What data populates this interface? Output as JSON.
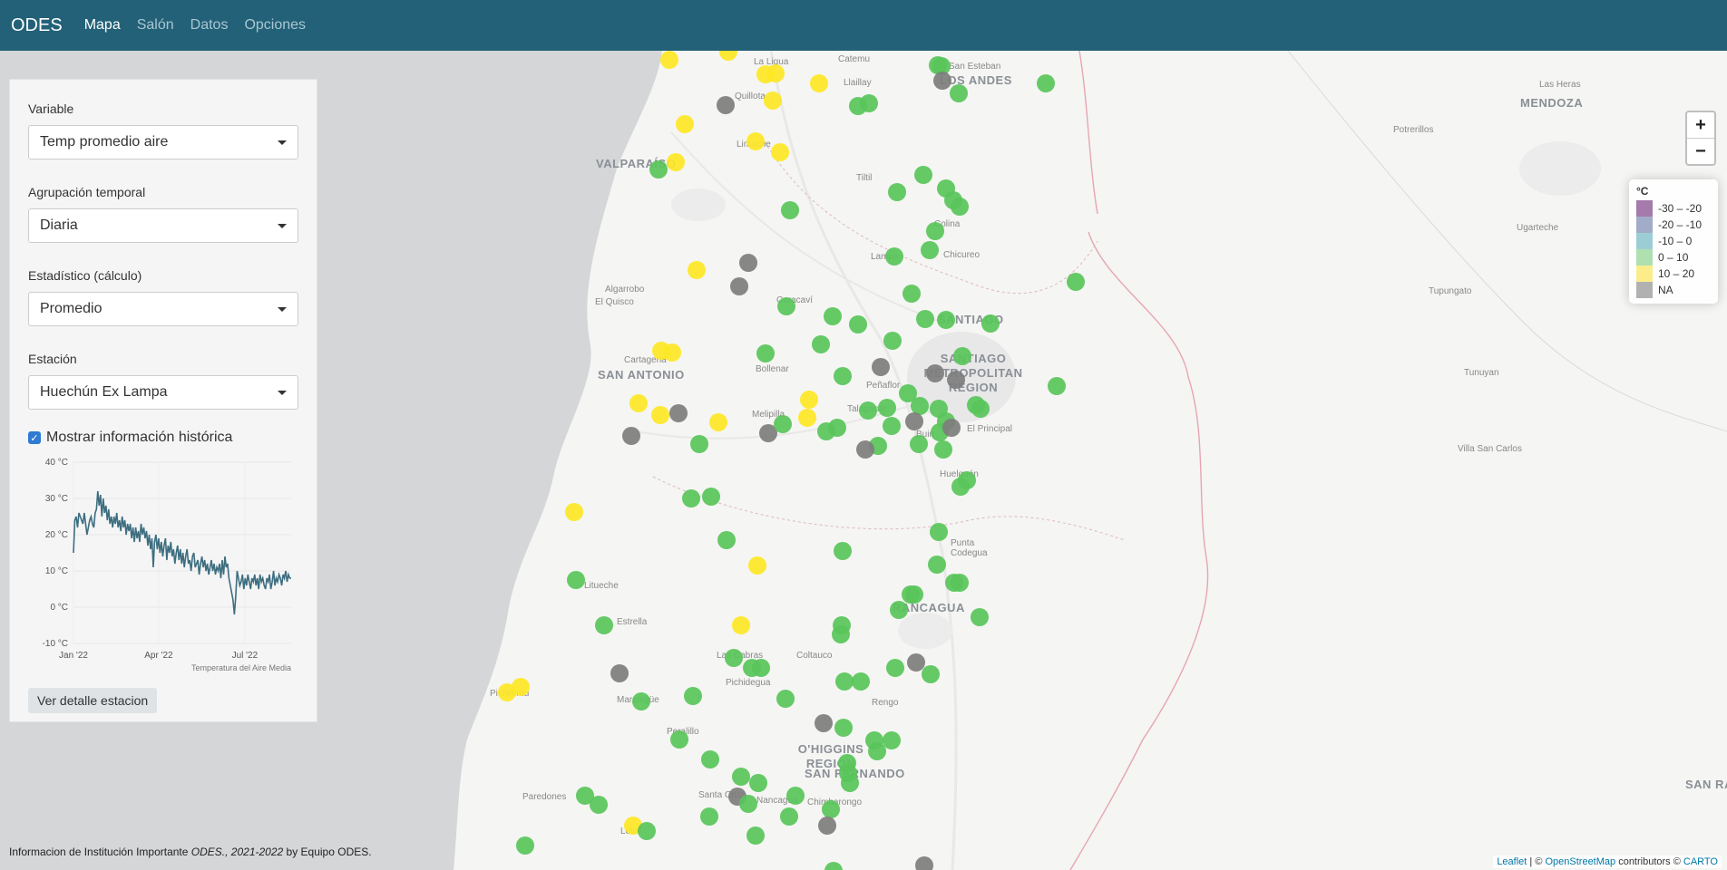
{
  "navbar": {
    "brand": "ODES",
    "items": [
      {
        "label": "Mapa",
        "active": true
      },
      {
        "label": "Salón",
        "active": false
      },
      {
        "label": "Datos",
        "active": false
      },
      {
        "label": "Opciones",
        "active": false
      }
    ]
  },
  "sidebar": {
    "variable": {
      "label": "Variable",
      "value": "Temp promedio aire"
    },
    "agrupacion": {
      "label": "Agrupación temporal",
      "value": "Diaria"
    },
    "estadistico": {
      "label": "Estadístico (cálculo)",
      "value": "Promedio"
    },
    "estacion": {
      "label": "Estación",
      "value": "Huechún Ex Lampa"
    },
    "historico_checkbox": {
      "label": "Mostrar información histórica",
      "checked": true
    },
    "detail_button": "Ver detalle estacion"
  },
  "chart_data": {
    "type": "line",
    "caption": "Temperatura del Aire Media",
    "yticks": [
      "40 °C",
      "30 °C",
      "20 °C",
      "10 °C",
      "0 °C",
      "-10 °C"
    ],
    "ylim": [
      -10,
      40
    ],
    "xticks": [
      "Jan '22",
      "Apr '22",
      "Jul '22"
    ],
    "x_tick_positions": [
      0,
      90,
      181
    ],
    "x_range": [
      0,
      230
    ],
    "line_color": "#3d6e80",
    "series": [
      {
        "values": [
          15,
          24,
          25,
          22,
          26,
          25,
          24,
          23,
          26,
          23,
          20,
          22,
          24,
          25,
          23,
          22,
          26,
          27,
          32,
          28,
          31,
          25,
          30,
          26,
          28,
          24,
          27,
          23,
          25,
          22,
          25,
          23,
          26,
          22,
          24,
          21,
          25,
          22,
          24,
          20,
          23,
          21,
          23,
          19,
          22,
          18,
          22,
          19,
          21,
          18,
          23,
          20,
          22,
          19,
          21,
          17,
          20,
          16,
          19,
          11,
          18,
          20,
          16,
          19,
          15,
          18,
          14,
          17,
          19,
          13,
          17,
          15,
          18,
          14,
          16,
          12,
          15,
          17,
          13,
          16,
          12,
          15,
          11,
          14,
          16,
          12,
          13,
          10,
          14,
          15,
          11,
          12,
          13,
          9,
          12,
          14,
          11,
          13,
          10,
          12,
          9,
          11,
          13,
          10,
          12,
          9,
          11,
          10,
          12,
          8,
          13,
          9,
          14,
          11,
          12,
          8,
          6,
          4,
          2,
          -2,
          3,
          10,
          8,
          6,
          7,
          9,
          5,
          8,
          6,
          9,
          7,
          5,
          8,
          7,
          9,
          6,
          8,
          5,
          9,
          7,
          8,
          6,
          5,
          8,
          7,
          9,
          5,
          7,
          10,
          6,
          8,
          7,
          9,
          8,
          6,
          9,
          8,
          10,
          7,
          9,
          8,
          8
        ]
      }
    ]
  },
  "legend": {
    "title": "°C",
    "items": [
      {
        "label": "-30 – -20",
        "color": "#8e5a96"
      },
      {
        "label": "-20 – -10",
        "color": "#8b97bb"
      },
      {
        "label": "-10 – 0",
        "color": "#84c1c9"
      },
      {
        "label": "0 – 10",
        "color": "#9ad89c"
      },
      {
        "label": "10 – 20",
        "color": "#fbe86d"
      },
      {
        "label": "NA",
        "color": "#9e9e9e"
      }
    ]
  },
  "map": {
    "colors": {
      "green": "#58c45a",
      "yellow": "#fde725",
      "gray": "#7d7d7d"
    },
    "places": [
      "LOS ANDES",
      "MENDOZA",
      "Las Heras",
      "Potrerillos",
      "Ugarteche",
      "Tupungato",
      "Tunuyan",
      "Villa San Carlos",
      "SAN RA",
      "VALPARAÍSO",
      "Quillota",
      "La Ligua",
      "Llaillay",
      "Catemu",
      "San Esteban",
      "Limache",
      "Tiltil",
      "Colina",
      "Chicureo",
      "Lampa",
      "Algarrobo",
      "El Quisco",
      "Curacaví",
      "Cartagena",
      "SAN ANTONIO",
      "SANTIAGO",
      "SANTIAGO METROPOLITAN REGION",
      "Bollenar",
      "Peñaflor",
      "Melipilla",
      "Talagante",
      "Buin",
      "El Principal",
      "Huelquén",
      "Punta Codegua",
      "RANCAGUA",
      "Litueche",
      "Estrella",
      "Las Cabras",
      "Pichidegua",
      "Coltauco",
      "Rengo",
      "Marchigüe",
      "Peralillo",
      "Pichilemu",
      "O'HIGGINS REGION",
      "SAN FERNANDO",
      "Paredones",
      "Santa Cruz",
      "Nancagua",
      "Chimbarongo",
      "Lolol"
    ],
    "zoom_in": "+",
    "zoom_out": "−"
  },
  "footer": {
    "text_before": "Informacion de Institución Importante ",
    "italic": "ODES., 2021-2022",
    "text_after": " by Equipo ODES."
  },
  "attribution": {
    "leaflet": "Leaflet",
    "sep": " | © ",
    "osm": "OpenStreetMap",
    "contrib": " contributors © ",
    "carto": "CARTO"
  }
}
